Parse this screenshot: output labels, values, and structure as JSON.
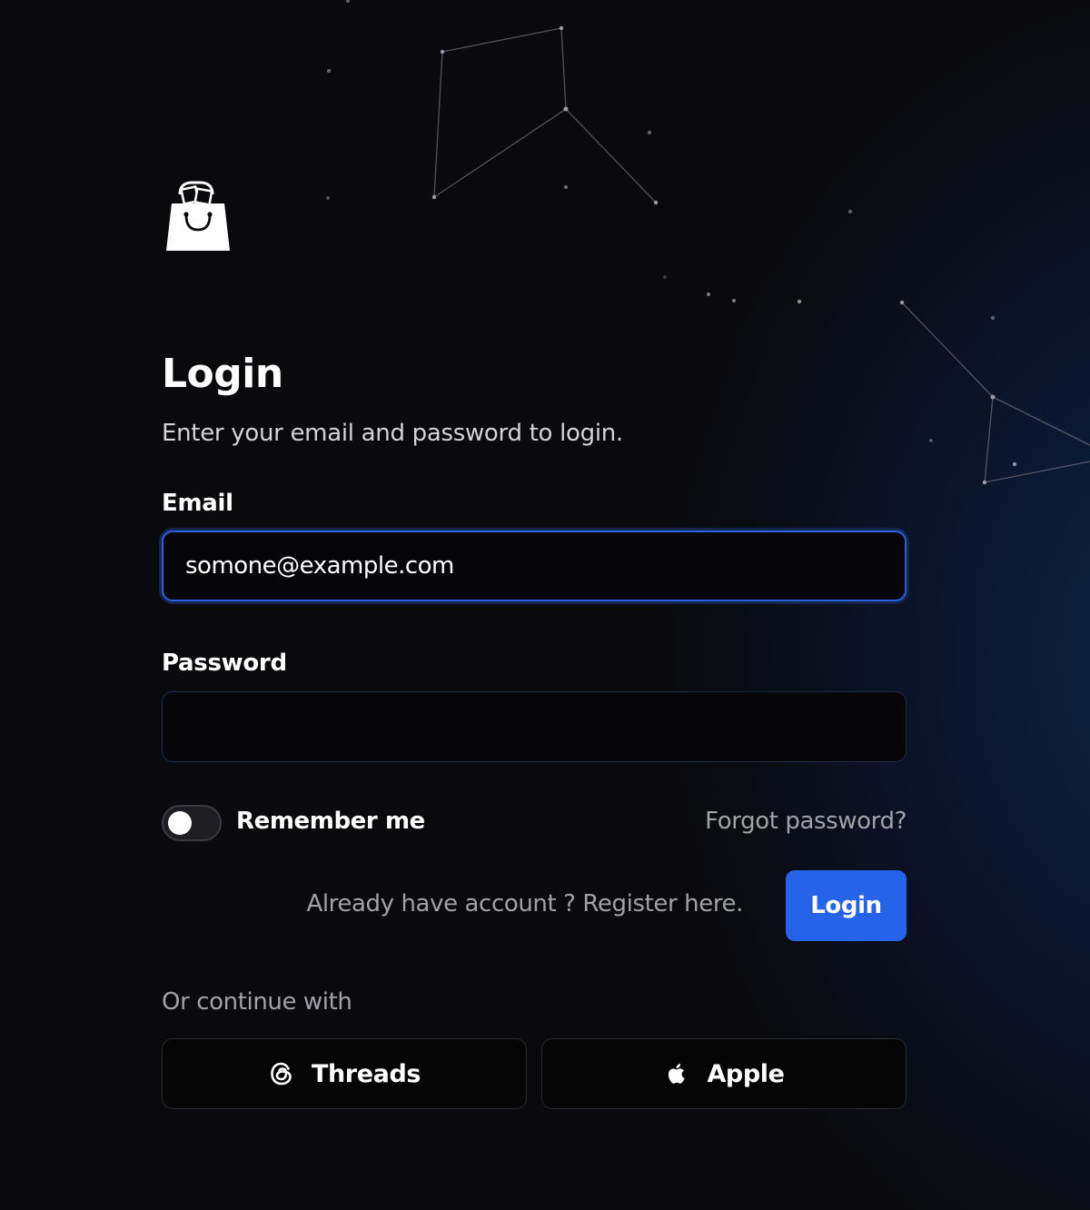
{
  "header": {
    "logo_icon": "shopping-bag-icon"
  },
  "login": {
    "title": "Login",
    "subtitle": "Enter your email and password to login.",
    "email_label": "Email",
    "email_value": "somone@example.com",
    "password_label": "Password",
    "password_value": "",
    "remember_label": "Remember me",
    "remember_checked": false,
    "forgot_label": "Forgot password?",
    "register_text": "Already have account ? Register here.",
    "submit_label": "Login"
  },
  "social": {
    "heading": "Or continue with",
    "providers": [
      {
        "label": "Threads",
        "icon": "threads-icon"
      },
      {
        "label": "Apple",
        "icon": "apple-icon"
      }
    ]
  },
  "colors": {
    "accent": "#2563eb",
    "background": "#0a0a0c"
  }
}
